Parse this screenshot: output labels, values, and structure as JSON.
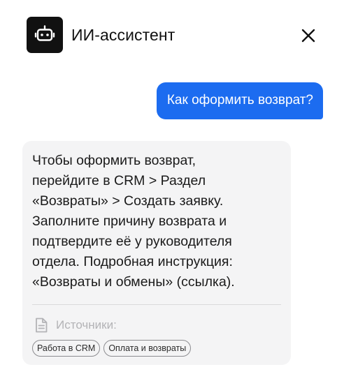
{
  "header": {
    "title": "ИИ-ассистент",
    "avatar_icon": "robot-icon",
    "close_icon": "close-icon"
  },
  "messages": {
    "user": "Как оформить возврат?",
    "bot": "Чтобы оформить возврат,\nперейдите в CRM > Раздел\n«Возвраты» > Создать заявку.\nЗаполните причину возврата и\nподтвердите её у руководителя\nотдела. Подробная инструкция:\n«Возвраты и обмены» (ссылка)."
  },
  "sources": {
    "label": "Источники:",
    "icon": "document-icon",
    "items": [
      "Работа в CRM",
      "Оплата и возвраты"
    ]
  },
  "colors": {
    "accent": "#1c6cf0",
    "bot_bubble": "#f4f4f5",
    "avatar_bg": "#111111"
  }
}
